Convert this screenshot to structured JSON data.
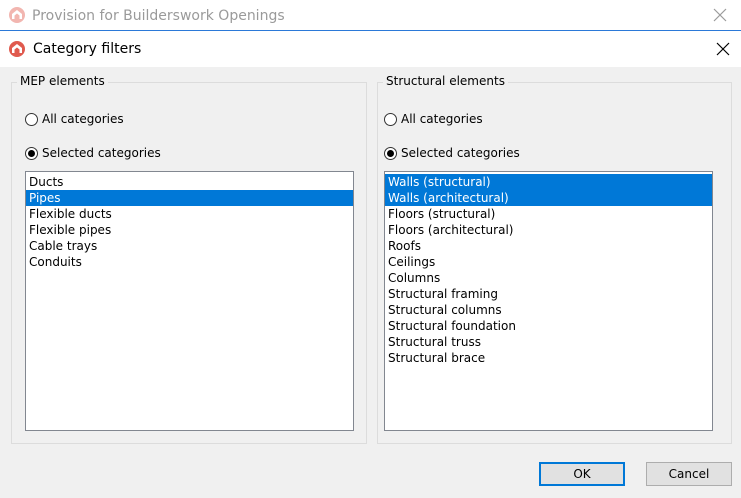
{
  "background_window": {
    "title": "Provision for Builderswork Openings"
  },
  "dialog": {
    "title": "Category filters"
  },
  "mep": {
    "group_title": "MEP elements",
    "radio_all": "All categories",
    "radio_selected": "Selected categories",
    "selected_mode": "selected",
    "items": [
      {
        "label": "Ducts",
        "selected": false
      },
      {
        "label": "Pipes",
        "selected": true
      },
      {
        "label": "Flexible ducts",
        "selected": false
      },
      {
        "label": "Flexible pipes",
        "selected": false
      },
      {
        "label": "Cable trays",
        "selected": false
      },
      {
        "label": "Conduits",
        "selected": false
      }
    ]
  },
  "structural": {
    "group_title": "Structural elements",
    "radio_all": "All categories",
    "radio_selected": "Selected categories",
    "selected_mode": "selected",
    "items": [
      {
        "label": "Walls (structural)",
        "selected": true
      },
      {
        "label": "Walls (architectural)",
        "selected": true
      },
      {
        "label": "Floors (structural)",
        "selected": false
      },
      {
        "label": "Floors (architectural)",
        "selected": false
      },
      {
        "label": "Roofs",
        "selected": false
      },
      {
        "label": "Ceilings",
        "selected": false
      },
      {
        "label": "Columns",
        "selected": false
      },
      {
        "label": "Structural framing",
        "selected": false
      },
      {
        "label": "Structural columns",
        "selected": false
      },
      {
        "label": "Structural foundation",
        "selected": false
      },
      {
        "label": "Structural truss",
        "selected": false
      },
      {
        "label": "Structural brace",
        "selected": false
      }
    ]
  },
  "buttons": {
    "ok": "OK",
    "cancel": "Cancel"
  },
  "icons": {
    "app": "app-logo-icon",
    "close": "close-icon"
  },
  "colors": {
    "selection": "#0078d7",
    "app_icon": "#e05a4e"
  }
}
